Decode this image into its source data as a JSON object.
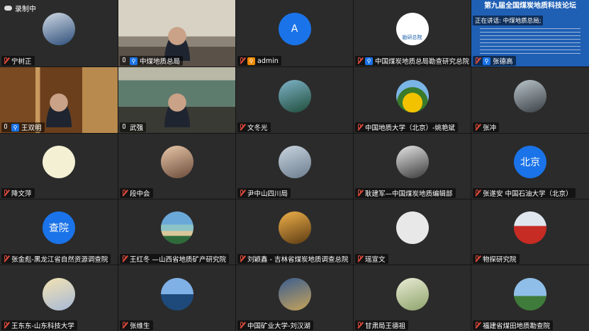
{
  "recording": {
    "label": "录制中"
  },
  "banner": {
    "title": "第九届全国煤炭地质科技论坛",
    "speaking": "正在讲话: 中煤地质总局;"
  },
  "colors": {
    "host": "#1a73e8",
    "cohost": "#f08a00",
    "muted": "#e04a3a",
    "avatar_blue": "#1a73e8"
  },
  "tiles": [
    {
      "name": "宁树正",
      "avatar": "photo-man",
      "status": "muted",
      "role": ""
    },
    {
      "name": "中煤地质总局",
      "avatar": "video-meeting",
      "status": "mic",
      "role": "host"
    },
    {
      "name": "admin",
      "avatar": "A",
      "status": "muted",
      "role": "cohost"
    },
    {
      "name": "中国煤炭地质总局勘查研究总院",
      "avatar": "logo",
      "logo_text": "勘研总院",
      "status": "muted",
      "role": "host"
    },
    {
      "name": "张德高",
      "avatar": "video-slides",
      "status": "muted",
      "role": "host"
    },
    {
      "name": "王双明",
      "avatar": "video-library",
      "status": "mic",
      "role": "host"
    },
    {
      "name": "武强",
      "avatar": "video-painting",
      "status": "mic",
      "role": ""
    },
    {
      "name": "文冬光",
      "avatar": "waterfall",
      "status": "muted",
      "role": ""
    },
    {
      "name": "中国地质大学（北京）-姚艳斌",
      "avatar": "sunflower",
      "status": "muted",
      "role": ""
    },
    {
      "name": "张冲",
      "avatar": "street",
      "status": "muted",
      "role": ""
    },
    {
      "name": "降文萍",
      "avatar": "cartoon",
      "status": "muted",
      "role": ""
    },
    {
      "name": "段中会",
      "avatar": "portrait",
      "status": "muted",
      "role": ""
    },
    {
      "name": "尹中山四川局",
      "avatar": "tower",
      "status": "muted",
      "role": ""
    },
    {
      "name": "耿建军—中国煤炭地质编辑部",
      "avatar": "bw-tree",
      "status": "muted",
      "role": ""
    },
    {
      "name": "张遂安 中国石油大学（北京）",
      "avatar": "北京",
      "status": "muted",
      "role": ""
    },
    {
      "name": "张金彪-黑龙江省自然资源调查院",
      "avatar": "查院",
      "status": "muted",
      "role": ""
    },
    {
      "name": "王红冬 —山西省地质矿产研究院",
      "avatar": "beach",
      "status": "muted",
      "role": ""
    },
    {
      "name": "刘颖鑫 - 吉林省煤炭地质调查总院",
      "avatar": "autumn",
      "status": "muted",
      "role": ""
    },
    {
      "name": "瑶宣文",
      "avatar": "default",
      "status": "muted",
      "role": ""
    },
    {
      "name": "物探研究院",
      "avatar": "flag",
      "status": "muted",
      "role": ""
    },
    {
      "name": "王东东-山东科技大学",
      "avatar": "kids",
      "status": "muted",
      "role": ""
    },
    {
      "name": "张维生",
      "avatar": "lake",
      "status": "muted",
      "role": ""
    },
    {
      "name": "中国矿业大学-刘汉湖",
      "avatar": "building",
      "status": "muted",
      "role": ""
    },
    {
      "name": "甘肃局王德祖",
      "avatar": "plant",
      "status": "muted",
      "role": ""
    },
    {
      "name": "福建省煤田地质勘查院",
      "avatar": "tree",
      "status": "muted",
      "role": ""
    }
  ]
}
